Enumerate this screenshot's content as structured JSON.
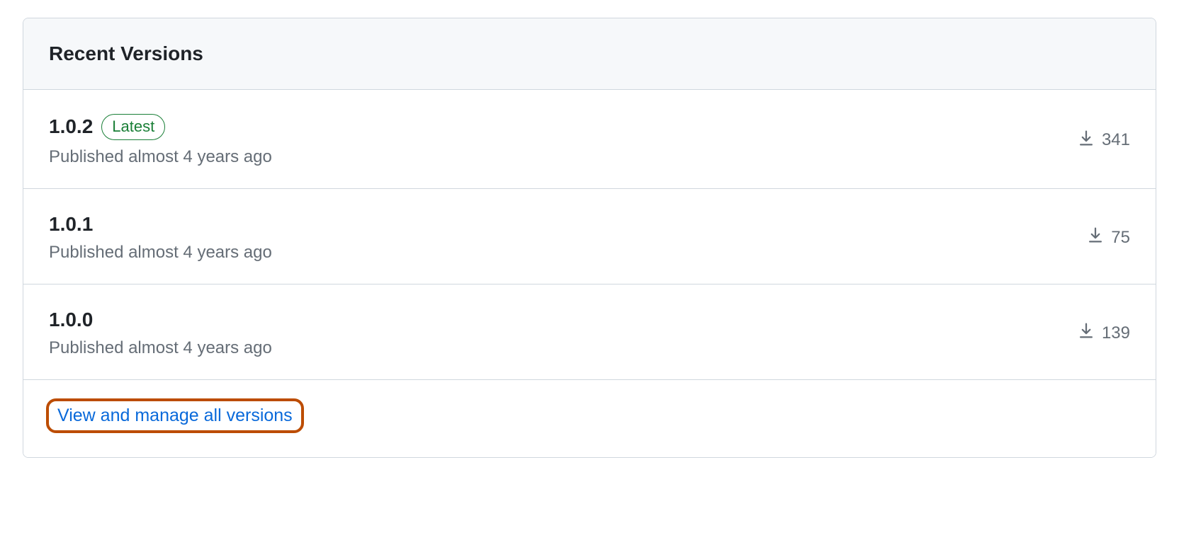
{
  "header": {
    "title": "Recent Versions"
  },
  "badge_latest": "Latest",
  "versions": [
    {
      "number": "1.0.2",
      "meta": "Published almost 4 years ago",
      "downloads": "341",
      "latest": true
    },
    {
      "number": "1.0.1",
      "meta": "Published almost 4 years ago",
      "downloads": "75",
      "latest": false
    },
    {
      "number": "1.0.0",
      "meta": "Published almost 4 years ago",
      "downloads": "139",
      "latest": false
    }
  ],
  "footer": {
    "manage_link": "View and manage all versions"
  }
}
